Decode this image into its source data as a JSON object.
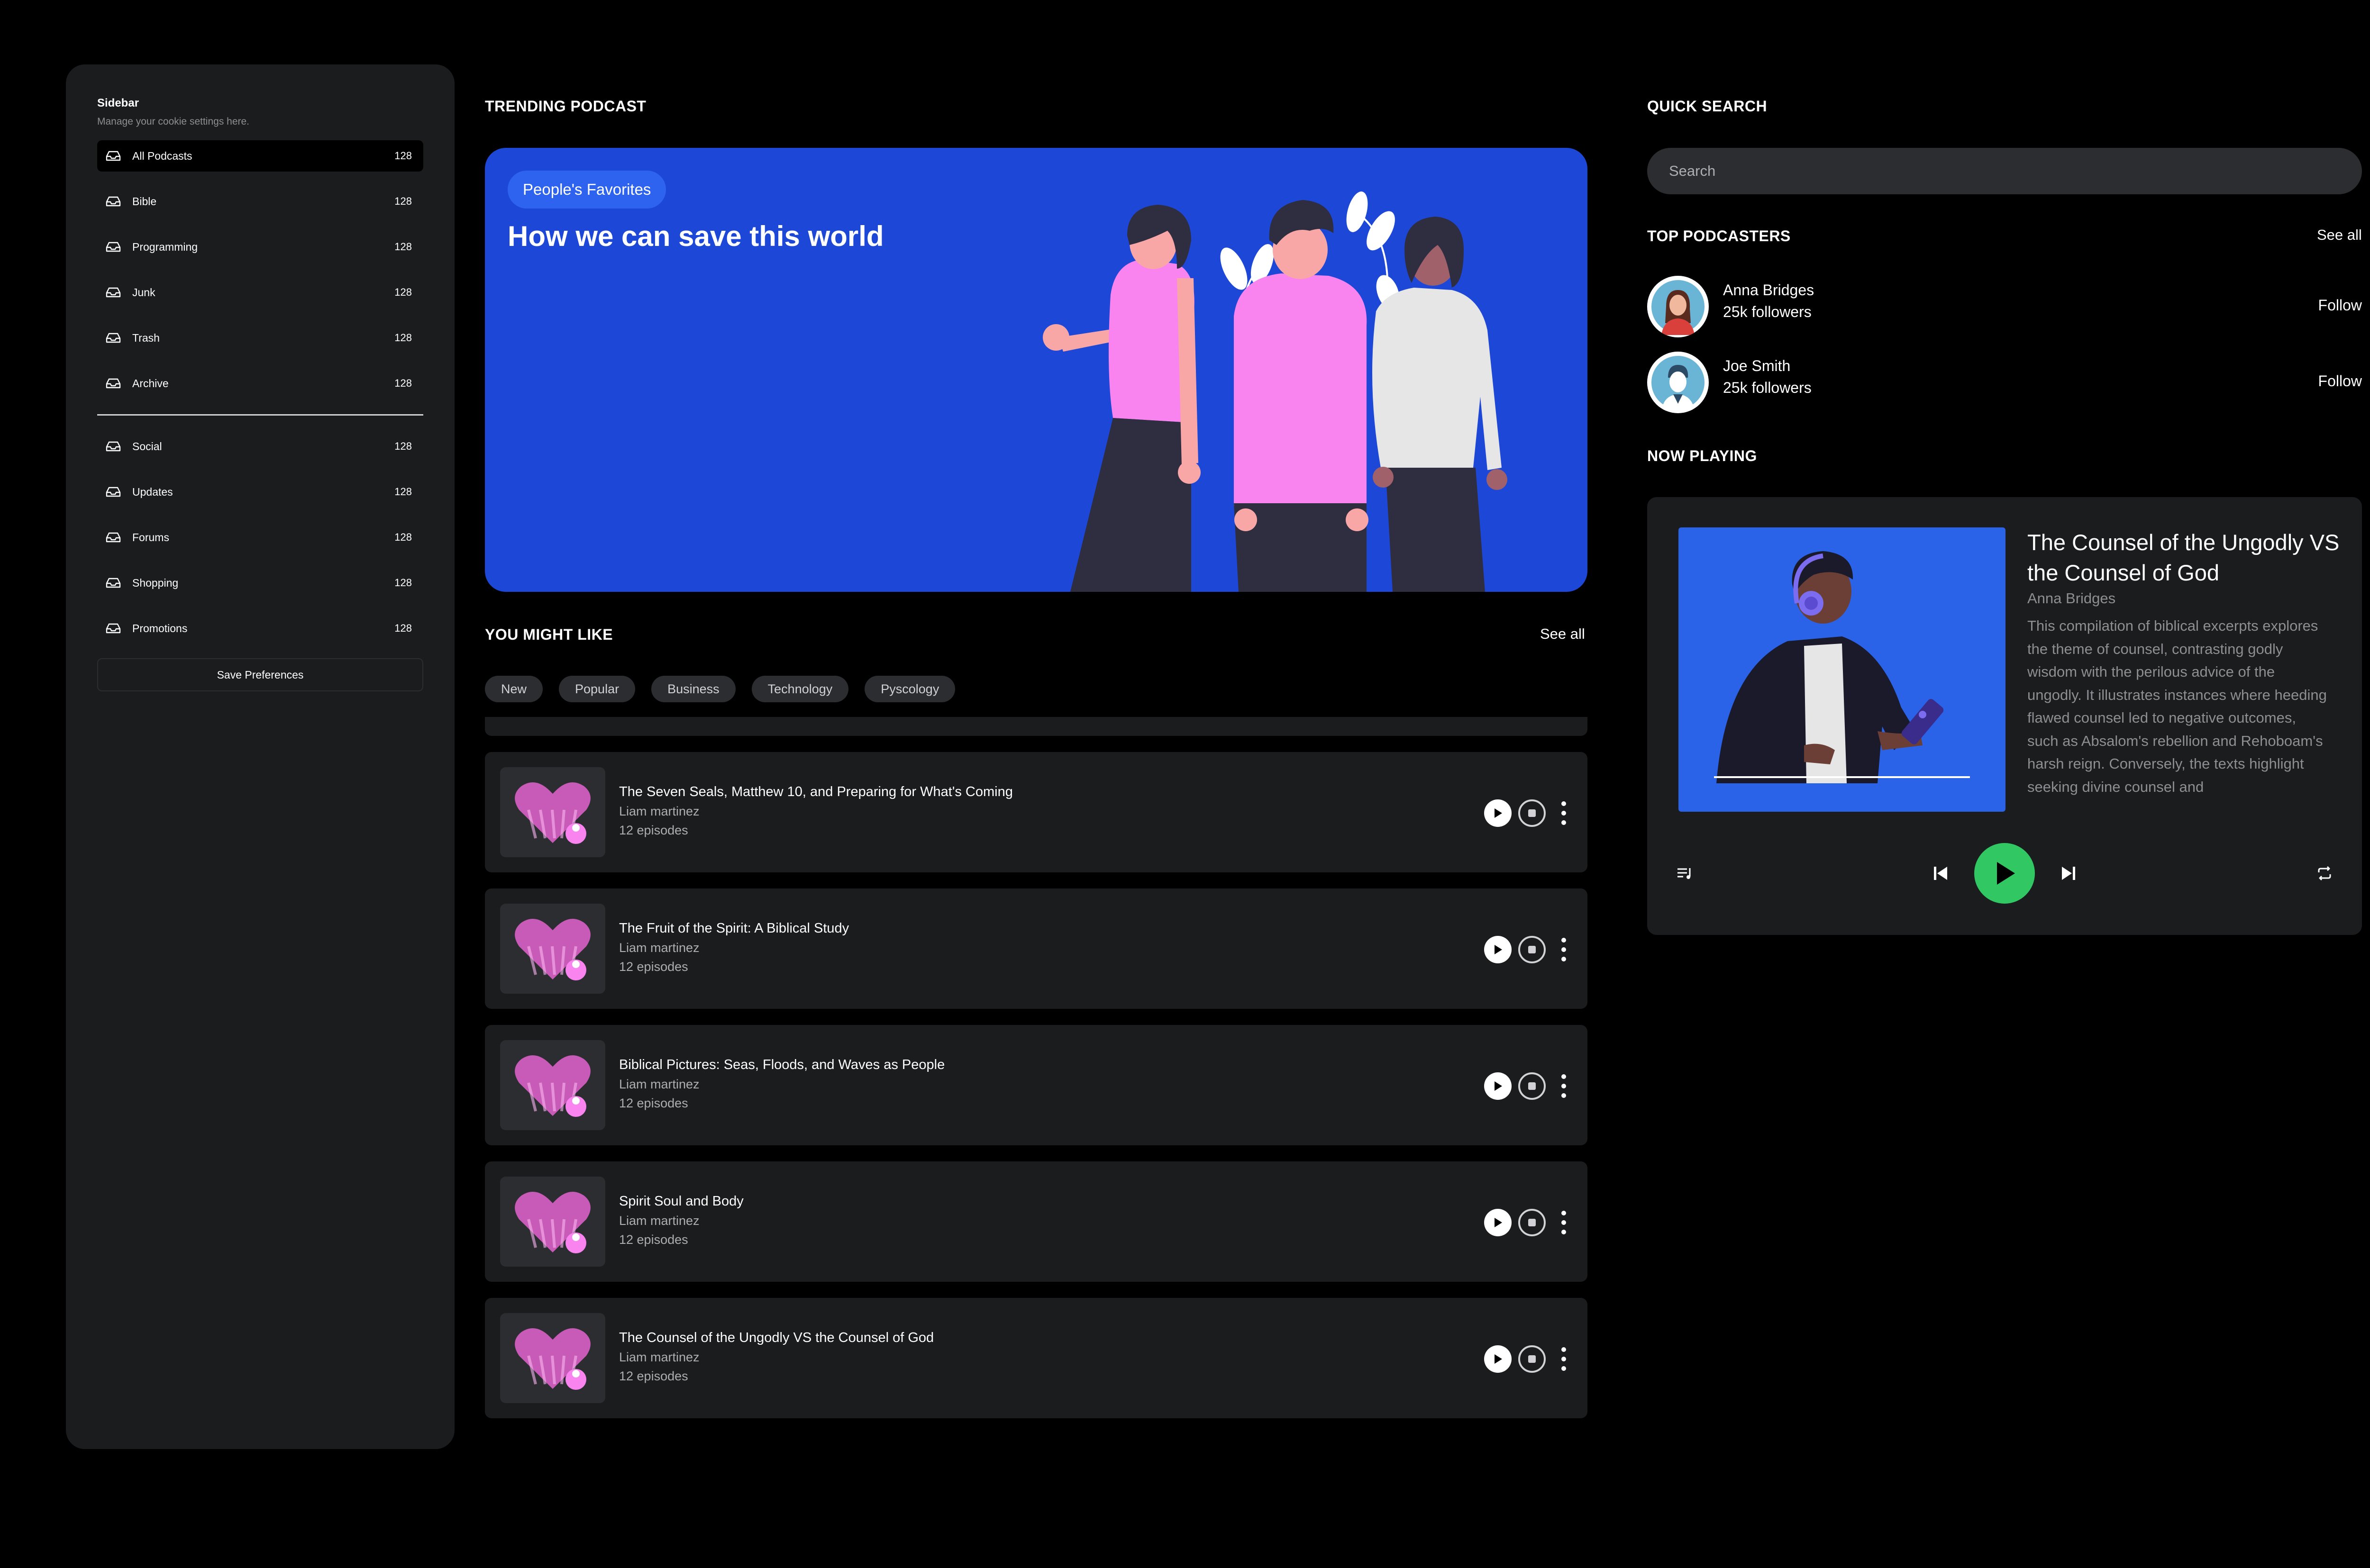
{
  "sidebar": {
    "title": "Sidebar",
    "subtitle": "Manage your cookie settings here.",
    "items": [
      {
        "label": "All Podcasts",
        "count": "128"
      },
      {
        "label": "Bible",
        "count": "128"
      },
      {
        "label": "Programming",
        "count": "128"
      },
      {
        "label": "Junk",
        "count": "128"
      },
      {
        "label": "Trash",
        "count": "128"
      },
      {
        "label": "Archive",
        "count": "128"
      }
    ],
    "items2": [
      {
        "label": "Social",
        "count": "128"
      },
      {
        "label": "Updates",
        "count": "128"
      },
      {
        "label": "Forums",
        "count": "128"
      },
      {
        "label": "Shopping",
        "count": "128"
      },
      {
        "label": "Promotions",
        "count": "128"
      }
    ],
    "save_label": "Save Preferences",
    "item_icon": "inbox-icon"
  },
  "trending": {
    "heading": "TRENDING PODCAST",
    "badge": "People's Favorites",
    "title": "How we can save this world"
  },
  "might_like": {
    "heading": "YOU MIGHT LIKE",
    "see_all": "See all",
    "filters": [
      "New",
      "Popular",
      "Business",
      "Technology",
      "Pyscology"
    ],
    "items": [
      {
        "title": "The Seven Seals, Matthew 10, and Preparing for What's Coming",
        "author": "Liam martinez",
        "episodes": "12 episodes"
      },
      {
        "title": "The Fruit of the Spirit: A Biblical Study",
        "author": "Liam martinez",
        "episodes": "12 episodes"
      },
      {
        "title": "Biblical Pictures: Seas, Floods, and Waves as People",
        "author": "Liam martinez",
        "episodes": "12 episodes"
      },
      {
        "title": "Spirit Soul and Body",
        "author": "Liam martinez",
        "episodes": "12 episodes"
      },
      {
        "title": "The Counsel of the Ungodly VS the Counsel of God",
        "author": "Liam martinez",
        "episodes": "12 episodes"
      }
    ]
  },
  "quick_search": {
    "heading": "QUICK SEARCH",
    "placeholder": "Search"
  },
  "top_podcasters": {
    "heading": "TOP PODCASTERS",
    "see_all": "See all",
    "items": [
      {
        "name": "Anna Bridges",
        "followers": "25k followers",
        "action": "Follow"
      },
      {
        "name": "Joe Smith",
        "followers": "25k followers",
        "action": "Follow"
      }
    ]
  },
  "now_playing": {
    "heading": "NOW PLAYING",
    "title": "The Counsel of the Ungodly VS the Counsel of God",
    "author": "Anna Bridges",
    "description": "This compilation of biblical excerpts explores the theme of counsel, contrasting godly wisdom with the perilous advice of the ungodly. It illustrates instances where heeding flawed counsel led to negative outcomes, such as Absalom's rebellion and Rehoboam's harsh reign. Conversely, the texts highlight seeking divine counsel and"
  },
  "colors": {
    "background": "#000000",
    "panel": "#1b1c1e",
    "hero_blue": "#1d47d6",
    "play_green": "#31c863",
    "pink": "#f984ef"
  }
}
